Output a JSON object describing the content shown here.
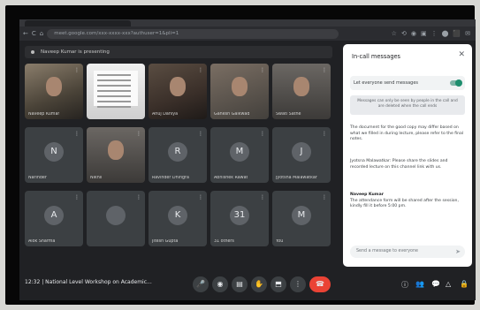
{
  "browser": {
    "nav_icons": [
      "←",
      "C",
      "⌂"
    ],
    "url": "meet.google.com/xxx-xxxx-xxx?authuser=1&pli=1",
    "ext_icons": [
      "☆",
      "⟲",
      "◉",
      "▣",
      "⋮",
      "⬤",
      "⬛",
      "✉"
    ]
  },
  "banner": {
    "text": "Naveep Kumar is presenting"
  },
  "tiles": [
    {
      "name": "Naveep Kumar",
      "kind": "photo-a"
    },
    {
      "name": "",
      "kind": "photo-b"
    },
    {
      "name": "Anuj Dahiya",
      "kind": "photo-c"
    },
    {
      "name": "Ganesh Gaikwad",
      "kind": "photo-d"
    },
    {
      "name": "Swati Sathe",
      "kind": "photo-e"
    },
    {
      "name": "Narinder",
      "kind": "avatar",
      "initial": "N"
    },
    {
      "name": "Nikhil",
      "kind": "photo-e"
    },
    {
      "name": "Ravinder Dhingra",
      "kind": "avatar",
      "initial": "R"
    },
    {
      "name": "Abhishek Rawat",
      "kind": "avatar",
      "initial": "M"
    },
    {
      "name": "Jyotsna Malawatkar",
      "kind": "avatar",
      "initial": "J"
    },
    {
      "name": "Alok Sharma",
      "kind": "avatar",
      "initial": "A"
    },
    {
      "name": "",
      "kind": "avatar",
      "initial": ""
    },
    {
      "name": "Jitesh Gupta",
      "kind": "avatar",
      "initial": "K"
    },
    {
      "name": "31 others",
      "kind": "avatar",
      "initial": "31"
    },
    {
      "name": "You",
      "kind": "avatar",
      "initial": "M"
    }
  ],
  "panel": {
    "title": "In-call messages",
    "close": "✕",
    "toggle_label": "Let everyone send messages",
    "notice": "Messages can only be seen by people in the call and are deleted when the call ends",
    "messages": [
      {
        "sender": "",
        "text": "The document for the good copy may differ based on what we filled in during lecture, please refer to the final notes."
      },
      {
        "sender": "",
        "text": "Jyotsna Malawatkar: Please share the slides and recorded lecture on this channel link with us."
      },
      {
        "sender": "Naveep Kumar",
        "text": "The attendance form will be shared after the session, kindly fill it before 5:00 pm."
      }
    ],
    "compose_placeholder": "Send a message to everyone",
    "send_icon": "➤"
  },
  "bottom": {
    "time": "12:32",
    "separator": "|",
    "meeting_title": "National Level Workshop on Academic...",
    "controls": [
      "🎤",
      "◉",
      "▤",
      "✋",
      "⬒",
      "⋮"
    ],
    "end_call": "☎",
    "right": [
      "ⓘ",
      "👥",
      "💬",
      "△",
      "🔒"
    ]
  }
}
